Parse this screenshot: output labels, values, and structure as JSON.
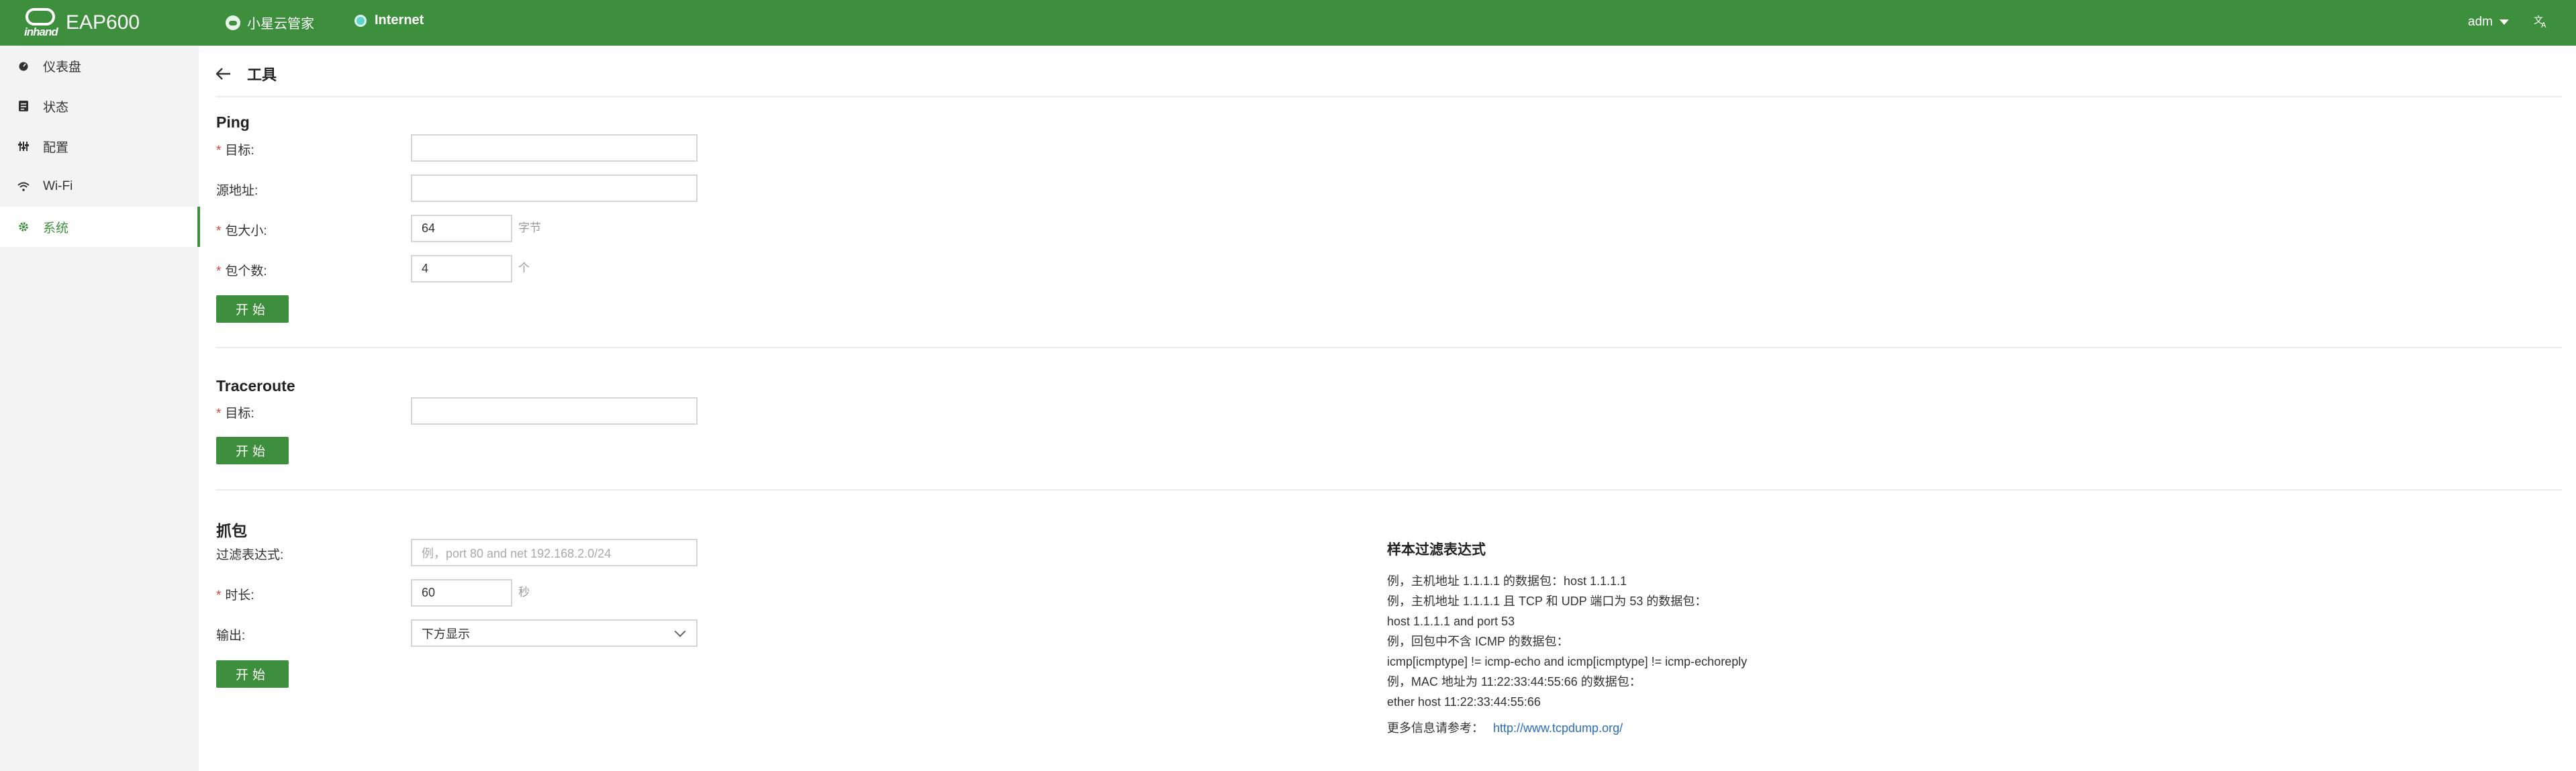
{
  "header": {
    "brand_logo_text": "inhand",
    "model": "EAP600",
    "cloud_label": "小星云管家",
    "internet_label": "Internet",
    "user": "adm",
    "lang_icon": "translate-icon"
  },
  "sidebar": {
    "items": [
      {
        "label": "仪表盘",
        "icon": "dashboard-icon"
      },
      {
        "label": "状态",
        "icon": "status-icon"
      },
      {
        "label": "配置",
        "icon": "config-icon"
      },
      {
        "label": "Wi-Fi",
        "icon": "wifi-icon"
      },
      {
        "label": "系统",
        "icon": "gear-icon",
        "active": true
      }
    ]
  },
  "page": {
    "title": "工具"
  },
  "ping": {
    "title": "Ping",
    "target_label": "目标:",
    "target_value": "",
    "source_label": "源地址:",
    "source_value": "",
    "size_label": "包大小:",
    "size_value": "64",
    "size_unit": "字节",
    "count_label": "包个数:",
    "count_value": "4",
    "count_unit": "个",
    "start": "开始"
  },
  "traceroute": {
    "title": "Traceroute",
    "target_label": "目标:",
    "target_value": "",
    "start": "开始"
  },
  "capture": {
    "title": "抓包",
    "filter_label": "过滤表达式:",
    "filter_placeholder": "例，port 80 and net 192.168.2.0/24",
    "duration_label": "时长:",
    "duration_value": "60",
    "duration_unit": "秒",
    "output_label": "输出:",
    "output_value": "下方显示",
    "start": "开始"
  },
  "help": {
    "title": "样本过滤表达式",
    "lines": [
      "例，主机地址 1.1.1.1 的数据包：host 1.1.1.1",
      "例，主机地址 1.1.1.1 且 TCP 和 UDP 端口为 53 的数据包：",
      "host 1.1.1.1 and port 53",
      "例，回包中不含 ICMP 的数据包：",
      "icmp[icmptype] != icmp-echo and icmp[icmptype] != icmp-echoreply",
      "例，MAC 地址为 11:22:33:44:55:66 的数据包：",
      "ether host 11:22:33:44:55:66"
    ],
    "more_label": "更多信息请参考：",
    "more_link": "http://www.tcpdump.org/"
  },
  "colors": {
    "accent": "#3d8f3d",
    "required": "#e04040",
    "link": "#2a6cc4"
  }
}
